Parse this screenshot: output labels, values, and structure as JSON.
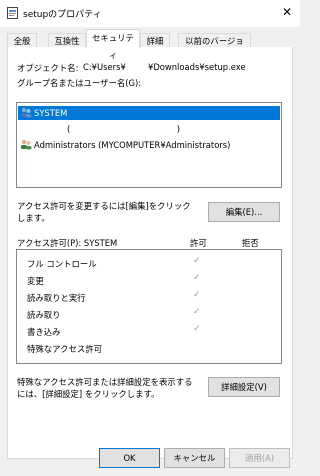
{
  "window": {
    "title": "setupのプロパティ"
  },
  "tabs": [
    {
      "label": "全般"
    },
    {
      "label": "互換性"
    },
    {
      "label": "セキュリティ"
    },
    {
      "label": "詳細"
    },
    {
      "label": "以前のバージョン"
    }
  ],
  "object": {
    "label": "オブジェクト名:",
    "path_prefix": "C:¥Users¥",
    "path_suffix": "¥Downloads¥setup.exe"
  },
  "groups": {
    "label": "グループ名またはユーザー名(G):",
    "items": [
      {
        "name": "SYSTEM",
        "selected": true
      },
      {
        "name": "(                                        )",
        "selected": false
      },
      {
        "name": "Administrators (MYCOMPUTER¥Administrators)",
        "selected": false
      }
    ]
  },
  "change_hint": "アクセス許可を変更するには[編集]をクリックします。",
  "edit_button": "編集(E)...",
  "permissions": {
    "label": "アクセス許可(P): SYSTEM",
    "allow_header": "許可",
    "deny_header": "拒否",
    "items": [
      {
        "name": "フル コントロール",
        "allow": true
      },
      {
        "name": "変更",
        "allow": true
      },
      {
        "name": "読み取りと実行",
        "allow": true
      },
      {
        "name": "読み取り",
        "allow": true
      },
      {
        "name": "書き込み",
        "allow": true
      },
      {
        "name": "特殊なアクセス許可",
        "allow": false
      }
    ]
  },
  "advanced_hint": "特殊なアクセス許可または詳細設定を表示するには、[詳細設定] をクリックします。",
  "advanced_button": "詳細設定(V)",
  "buttons": {
    "ok": "OK",
    "cancel": "キャンセル",
    "apply": "適用(A)"
  },
  "icons": {
    "app": "file-icon",
    "close": "close-icon",
    "user": "user-group-icon",
    "check": "checkmark-icon"
  },
  "colors": {
    "selection": "#0078d7",
    "check": "#9a9a9a"
  }
}
